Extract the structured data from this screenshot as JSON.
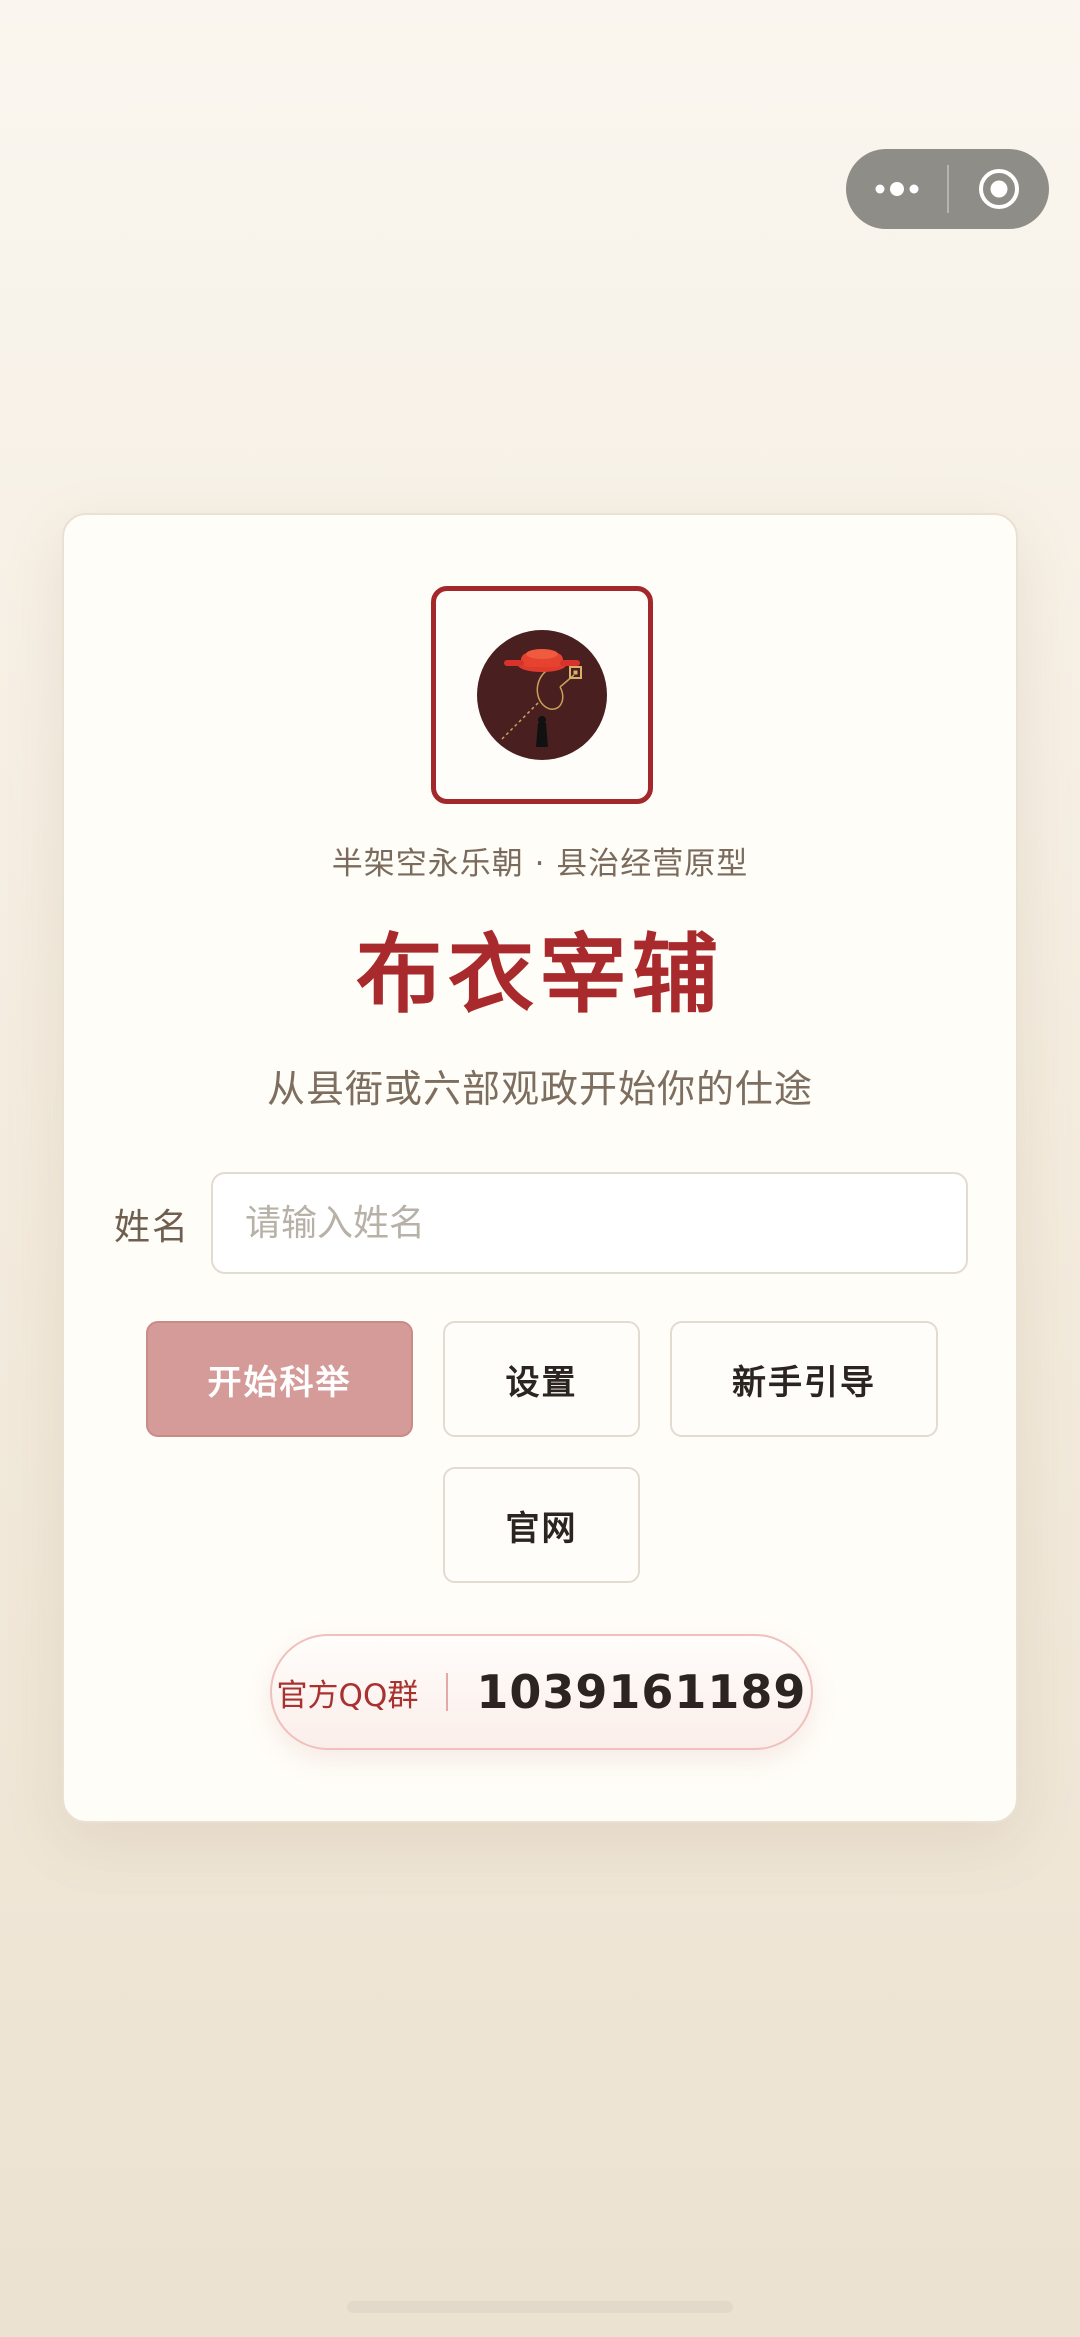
{
  "capsule": {
    "more_icon": "more-dots-icon",
    "close_icon": "target-circle-icon"
  },
  "card": {
    "logo_icon": "official-hat-emblem-icon",
    "tagline": "半架空永乐朝 · 县治经营原型",
    "title": "布衣宰辅",
    "subtitle": "从县衙或六部观政开始你的仕途",
    "name_field": {
      "label": "姓名",
      "placeholder": "请输入姓名",
      "value": ""
    },
    "buttons": {
      "start": "开始科举",
      "settings": "设置",
      "guide": "新手引导",
      "website": "官网"
    },
    "qq_group": {
      "label": "官方QQ群",
      "number": "1039161189"
    }
  },
  "colors": {
    "accent": "#a82a2c",
    "start_button": "#d49b98",
    "background": "#f6efe4"
  }
}
